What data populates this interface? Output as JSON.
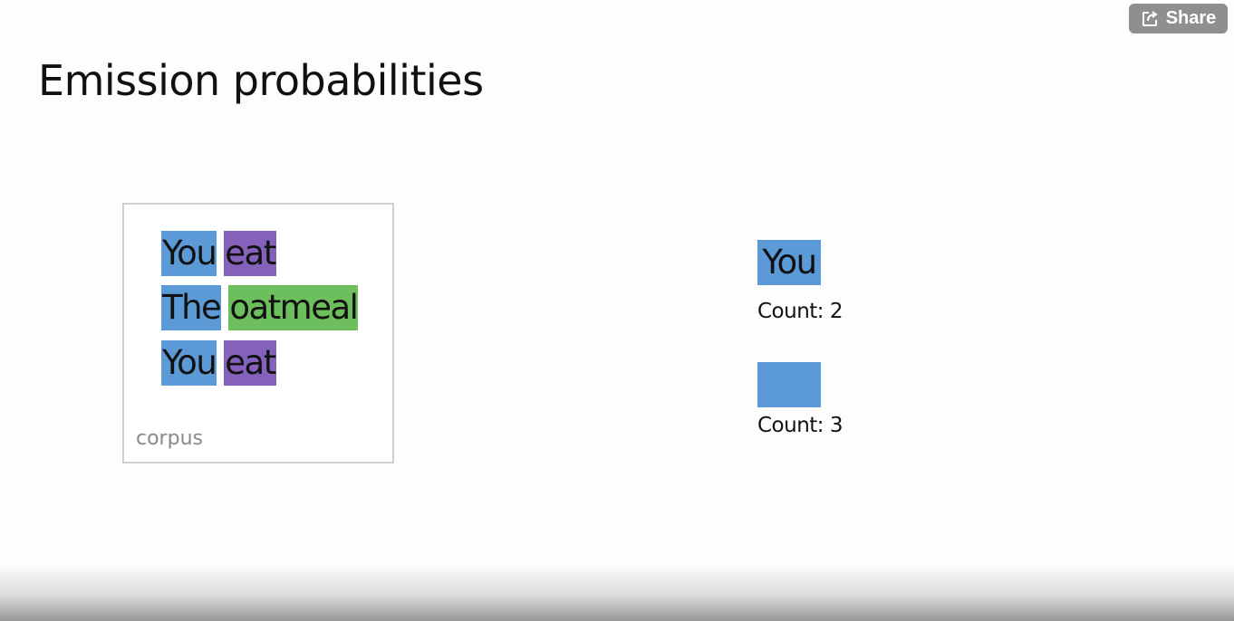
{
  "share_button": {
    "label": "Share",
    "icon": "share-icon"
  },
  "slide": {
    "title": "Emission probabilities",
    "corpus": {
      "label": "corpus",
      "sentences": [
        [
          {
            "text": "You",
            "tag_color": "#5b9ad6"
          },
          {
            "text": "eat",
            "tag_color": "#8461bb"
          }
        ],
        [
          {
            "text": "The",
            "tag_color": "#5b9ad6"
          },
          {
            "text": "oatmeal",
            "tag_color": "#6dbf5d"
          }
        ],
        [
          {
            "text": "You",
            "tag_color": "#5b9ad6"
          },
          {
            "text": "eat",
            "tag_color": "#8461bb"
          }
        ]
      ]
    },
    "word_count": {
      "word": "You",
      "tag_color": "#5b9ad6",
      "label": "Count: 2"
    },
    "tag_count": {
      "tag_color": "#5b9ad6",
      "label": "Count: 3"
    }
  },
  "colors": {
    "blue_tag": "#5b9ad6",
    "purple_tag": "#8461bb",
    "green_tag": "#6dbf5d"
  }
}
